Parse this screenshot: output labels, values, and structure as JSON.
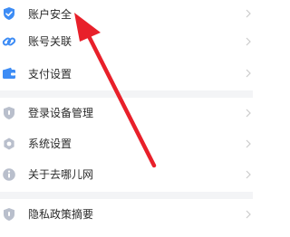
{
  "menu": {
    "items": [
      {
        "label": "账户安全",
        "icon": "shield-check-icon"
      },
      {
        "label": "账号关联",
        "icon": "link-icon"
      },
      {
        "label": "支付设置",
        "icon": "wallet-icon"
      },
      {
        "label": "登录设备管理",
        "icon": "shield-icon"
      },
      {
        "label": "系统设置",
        "icon": "gear-icon"
      },
      {
        "label": "关于去哪儿网",
        "icon": "info-icon"
      },
      {
        "label": "隐私政策摘要",
        "icon": "shield-icon"
      }
    ]
  },
  "colors": {
    "accent_blue": "#3d8cf5",
    "muted_icon": "#b9bfcc",
    "annotation_red": "#e8202a",
    "divider": "#f3f4f6"
  },
  "annotation": {
    "type": "arrow",
    "icon": "red-arrow-icon"
  }
}
